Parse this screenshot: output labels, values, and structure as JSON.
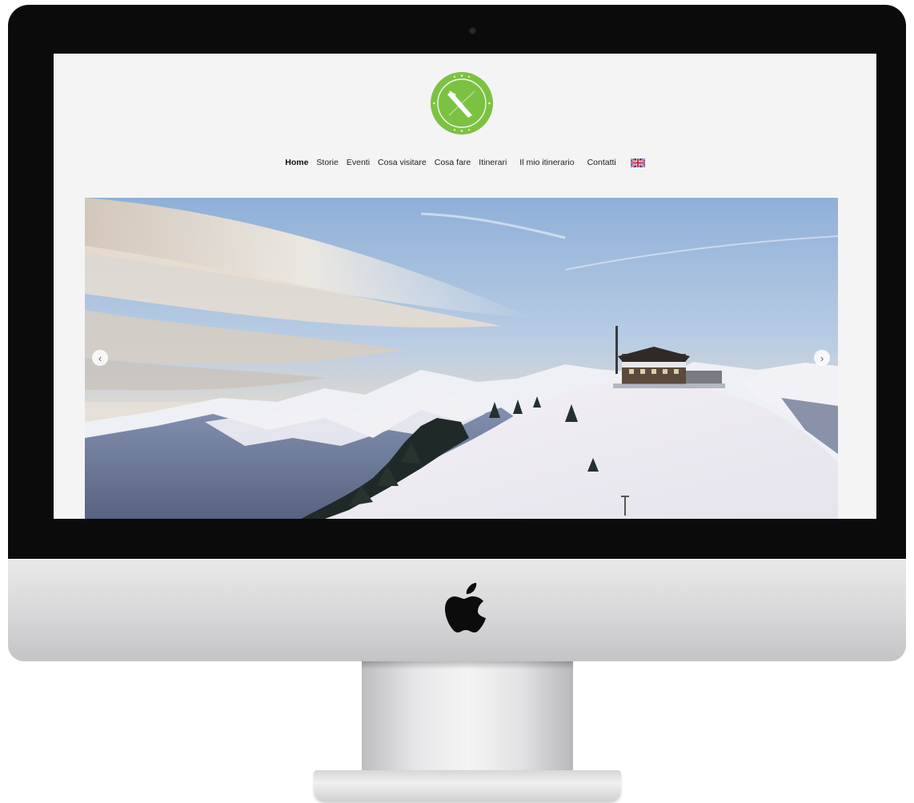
{
  "nav": {
    "items": [
      {
        "label": "Home"
      },
      {
        "label": "Storie"
      },
      {
        "label": "Eventi"
      },
      {
        "label": "Cosa visitare"
      },
      {
        "label": "Cosa fare"
      },
      {
        "label": "Itinerari"
      },
      {
        "label": "Il mio itinerario"
      },
      {
        "label": "Contatti"
      }
    ],
    "active": "Home",
    "language_icon": "flag-uk-icon"
  },
  "slider": {
    "prev_label": "‹",
    "next_label": "›"
  },
  "colors": {
    "logo_green": "#7cc242",
    "screen_background": "#f4f4f4",
    "nav_text": "#222222"
  },
  "icons": [
    "compass-logo-icon",
    "apple-logo-icon",
    "flag-uk-icon",
    "chevron-left-icon",
    "chevron-right-icon"
  ]
}
